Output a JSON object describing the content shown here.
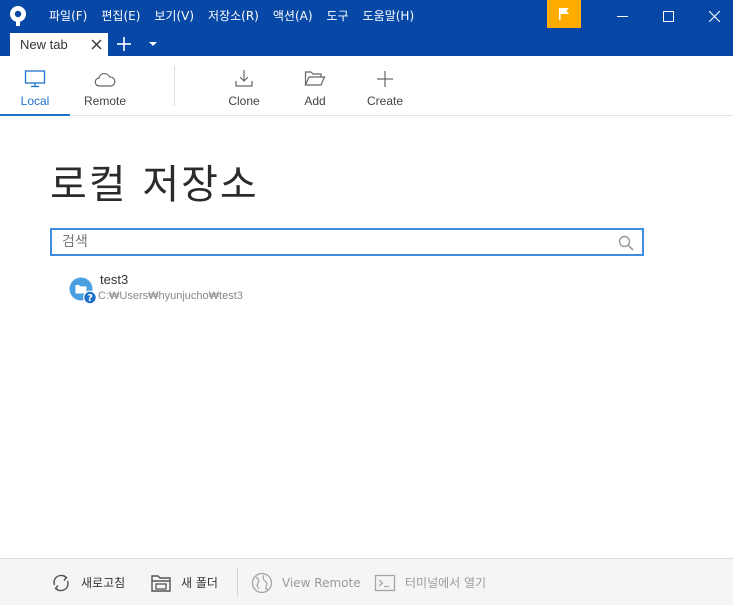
{
  "menu": [
    "파일(F)",
    "편집(E)",
    "보기(V)",
    "저장소(R)",
    "액션(A)",
    "도구",
    "도움말(H)"
  ],
  "tab": {
    "label": "New tab"
  },
  "toolbar": {
    "local": "Local",
    "remote": "Remote",
    "clone": "Clone",
    "add": "Add",
    "create": "Create"
  },
  "main": {
    "title": "로컬 저장소",
    "search_placeholder": "검색"
  },
  "repos": [
    {
      "name": "test3",
      "path": "C:₩Users₩hyunjucho₩test3"
    }
  ],
  "bottombar": {
    "refresh": "새로고침",
    "new_folder": "새 폴더",
    "view_remote": "View Remote",
    "open_terminal": "터미널에서 열기"
  },
  "colors": {
    "titlebar": "#0747a6",
    "flag": "#ffab00",
    "accent": "#1f72c9"
  }
}
